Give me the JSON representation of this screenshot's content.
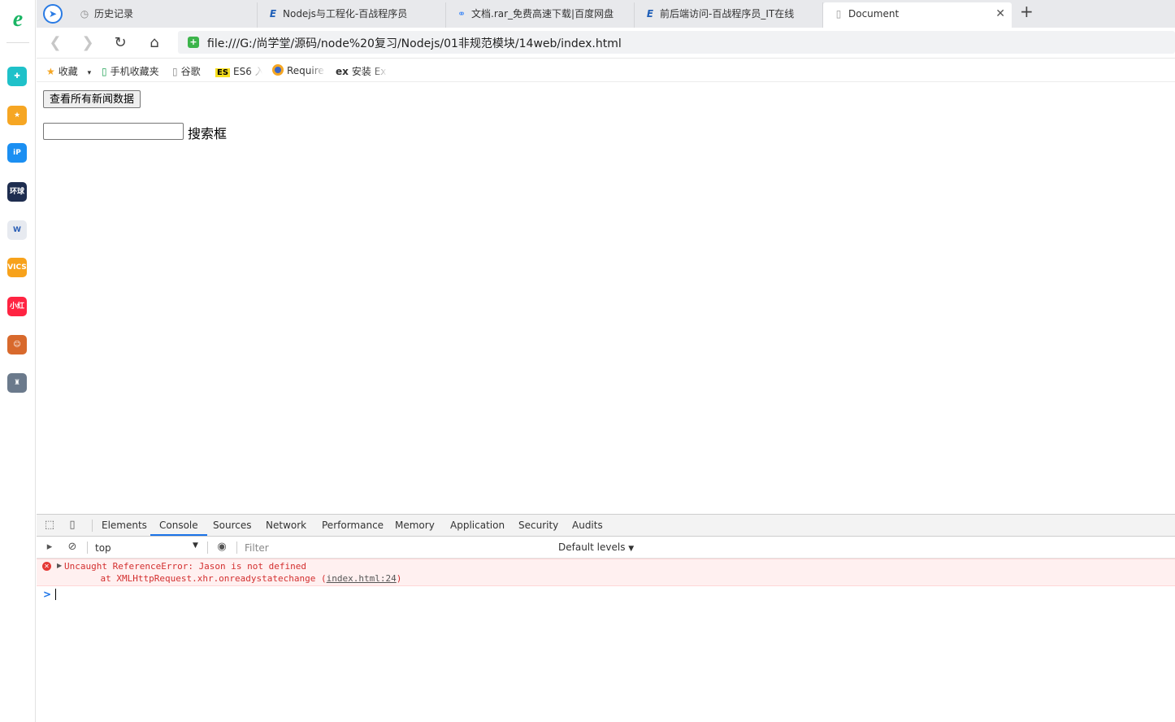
{
  "sidebar": {
    "logo": "e",
    "apps": [
      {
        "name": "plus-app-icon",
        "glyph": "✚",
        "color": "#1fc1c9"
      },
      {
        "name": "favorites-app-icon",
        "glyph": "★",
        "color": "#f6a623"
      },
      {
        "name": "p-app-icon",
        "glyph": "iP",
        "color": "#1b8ff2"
      },
      {
        "name": "news-app-icon",
        "glyph": "环球",
        "color": "#1e2d4f"
      },
      {
        "name": "word-app-icon",
        "glyph": "W",
        "color": "#e7eaf0"
      },
      {
        "name": "game-app-icon",
        "glyph": "VICS",
        "color": "#f7a21b"
      },
      {
        "name": "xiaohongshu-app-icon",
        "glyph": "小红书",
        "color": "#ff2442"
      },
      {
        "name": "character-app-icon",
        "glyph": "☺",
        "color": "#d8692c"
      },
      {
        "name": "pubg-app-icon",
        "glyph": "♜",
        "color": "#6b7a8c"
      }
    ]
  },
  "tabs": [
    {
      "label": "历史记录",
      "icon": "history-icon",
      "glyph": "◷"
    },
    {
      "label": "Nodejs与工程化-百战程序员",
      "icon": "bz-icon",
      "glyph": "E"
    },
    {
      "label": "文档.rar_免费高速下载|百度网盘",
      "icon": "baidu-pan-icon",
      "glyph": "⚭"
    },
    {
      "label": "前后端访问-百战程序员_IT在线",
      "icon": "bz-icon",
      "glyph": "E"
    },
    {
      "label": "Document",
      "icon": "document-icon",
      "glyph": "▯"
    }
  ],
  "address": {
    "url": "file:///G:/尚学堂/源码/node%20复习/Nodejs/01非规范模块/14web/index.html"
  },
  "bookmarks": [
    {
      "label": "收藏",
      "icon": "star-icon"
    },
    {
      "label": "手机收藏夹",
      "icon": "phone-icon"
    },
    {
      "label": "谷歌",
      "icon": "page-icon"
    },
    {
      "label": "ES6 入",
      "icon": "es-icon"
    },
    {
      "label": "Require",
      "icon": "requirejs-icon"
    },
    {
      "label": "安装 Ex",
      "icon": "express-icon"
    }
  ],
  "page": {
    "button_label": "查看所有新闻数据",
    "search_label": "搜索框",
    "search_value": ""
  },
  "devtools": {
    "tabs": [
      "Elements",
      "Console",
      "Sources",
      "Network",
      "Performance",
      "Memory",
      "Application",
      "Security",
      "Audits"
    ],
    "active_tab": "Console",
    "context": "top",
    "filter_placeholder": "Filter",
    "levels_label": "Default levels",
    "error": {
      "message": "Uncaught ReferenceError: Jason is not defined",
      "stack_prefix": "    at XMLHttpRequest.xhr.onreadystatechange (",
      "link": "index.html:24",
      "stack_suffix": ")"
    },
    "prompt": ">"
  }
}
